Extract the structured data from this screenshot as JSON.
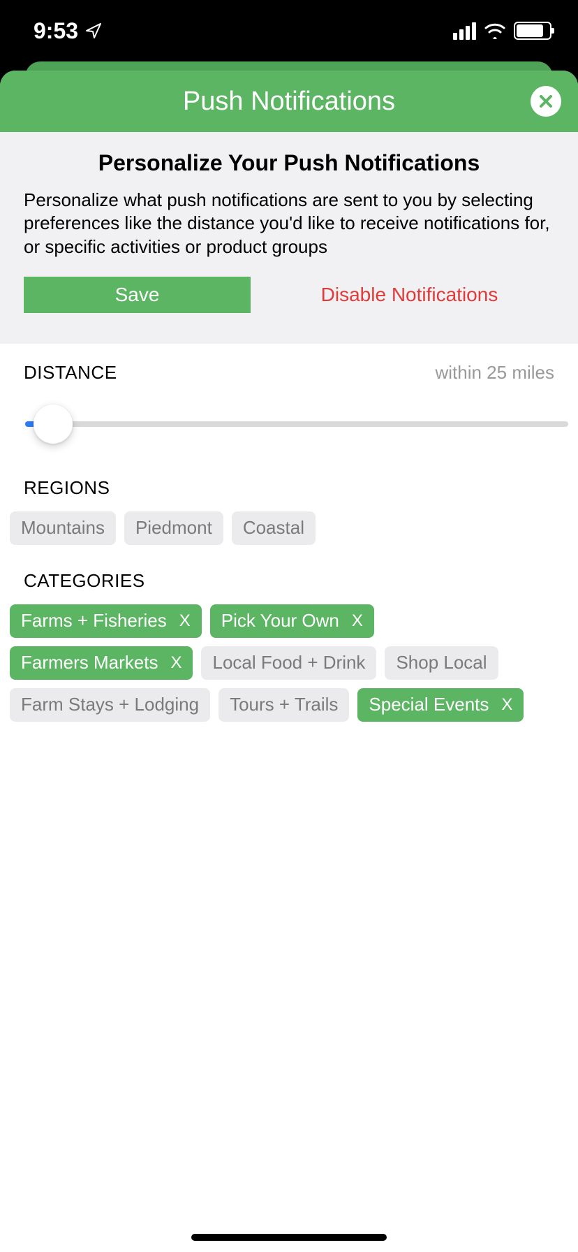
{
  "statusBar": {
    "time": "9:53"
  },
  "header": {
    "title": "Push Notifications"
  },
  "intro": {
    "heading": "Personalize Your Push Notifications",
    "text": "Personalize what push notifications are sent to you by selecting preferences like the distance you'd like to receive notifications for, or specific activities or product groups",
    "saveLabel": "Save",
    "disableLabel": "Disable Notifications"
  },
  "distance": {
    "label": "DISTANCE",
    "value": "within 25 miles"
  },
  "regions": {
    "label": "REGIONS",
    "items": [
      {
        "name": "Mountains",
        "selected": false
      },
      {
        "name": "Piedmont",
        "selected": false
      },
      {
        "name": "Coastal",
        "selected": false
      }
    ]
  },
  "categories": {
    "label": "CATEGORIES",
    "items": [
      {
        "name": "Farms + Fisheries",
        "selected": true
      },
      {
        "name": "Pick Your Own",
        "selected": true
      },
      {
        "name": "Farmers Markets",
        "selected": true
      },
      {
        "name": "Local Food + Drink",
        "selected": false
      },
      {
        "name": "Shop Local",
        "selected": false
      },
      {
        "name": "Farm Stays + Lodging",
        "selected": false
      },
      {
        "name": "Tours + Trails",
        "selected": false
      },
      {
        "name": "Special Events",
        "selected": true
      }
    ]
  },
  "colors": {
    "primary": "#5bb563",
    "danger": "#e03b3b",
    "chipOff": "#ebebed"
  }
}
